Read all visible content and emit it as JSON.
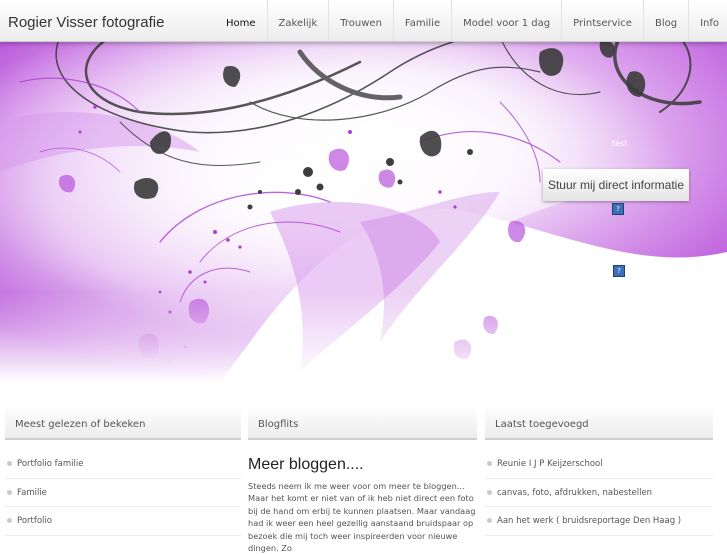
{
  "site": {
    "title": "Rogier Visser fotografie"
  },
  "nav": {
    "items": [
      {
        "label": "Home",
        "active": true
      },
      {
        "label": "Zakelijk"
      },
      {
        "label": "Trouwen"
      },
      {
        "label": "Familie"
      },
      {
        "label": "Model voor 1 dag"
      },
      {
        "label": "Printservice"
      },
      {
        "label": "Blog"
      },
      {
        "label": "Info"
      }
    ]
  },
  "hero": {
    "text": "test",
    "cta_label": "Stuur mij direct informatie",
    "icon_glyph": "?",
    "accent": "#b44ad8"
  },
  "columns": {
    "popular": {
      "heading": "Meest gelezen of bekeken",
      "items": [
        "Portfolio familie",
        "Familie",
        "Portfolio"
      ]
    },
    "blog": {
      "heading": "Blogflits",
      "post_title": "Meer bloggen....",
      "post_text": "Steeds neem ik me weer voor om meer te bloggen... Maar het komt er niet van of ik heb niet direct een foto bij de hand om erbij te kunnen plaatsen. Maar vandaag had ik weer een heel gezellig aanstaand bruidspaar op bezoek die mij toch weer inspireerden voor nieuwe dingen. Zo"
    },
    "recent": {
      "heading": "Laatst toegevoegd",
      "items": [
        "Reunie I J P Keijzerschool",
        "canvas, foto, afdrukken, nabestellen",
        "Aan het werk ( bruidsreportage Den Haag )"
      ]
    }
  }
}
